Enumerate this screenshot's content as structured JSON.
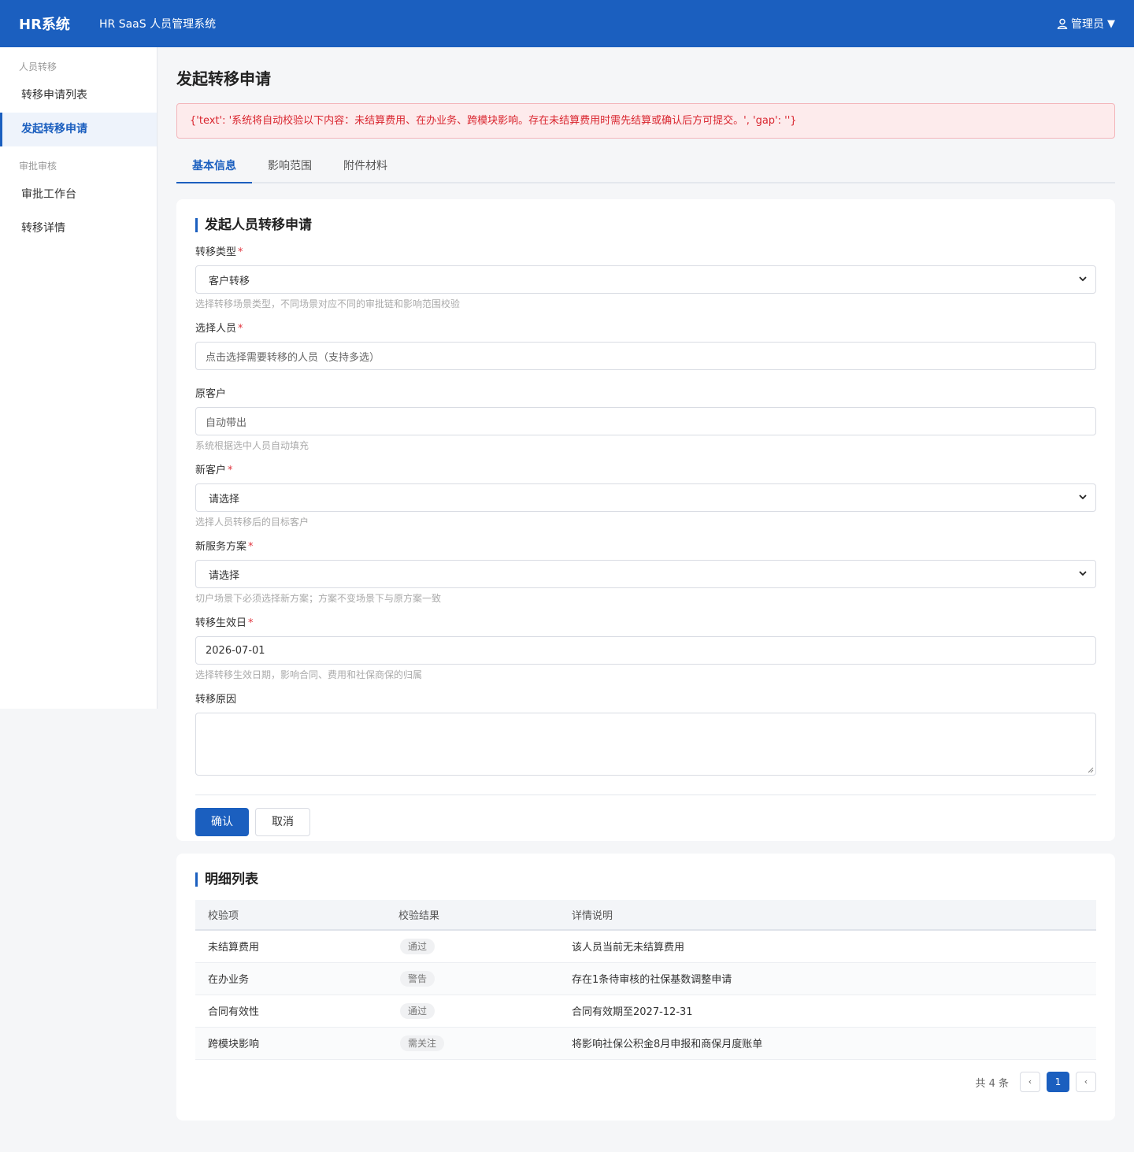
{
  "header": {
    "brand": "HR系统",
    "subtitle": "HR SaaS 人员管理系统",
    "user": "管理员",
    "caret": "▼"
  },
  "sidebar": {
    "groups": [
      {
        "title": "人员转移",
        "items": [
          "转移申请列表",
          "发起转移申请"
        ]
      },
      {
        "title": "审批审核",
        "items": [
          "审批工作台",
          "转移详情"
        ]
      }
    ],
    "active": "发起转移申请"
  },
  "page": {
    "title": "发起转移申请",
    "alert": "{'text': '系统将自动校验以下内容：未结算费用、在办业务、跨模块影响。存在未结算费用时需先结算或确认后方可提交。', 'gap': ''}"
  },
  "tabs": [
    "基本信息",
    "影响范围",
    "附件材料"
  ],
  "form": {
    "title": "发起人员转移申请",
    "required_mark": "*",
    "fields": {
      "transfer_type": {
        "label": "转移类型",
        "value": "客户转移",
        "hint": "选择转移场景类型，不同场景对应不同的审批链和影响范围校验"
      },
      "personnel": {
        "label": "选择人员",
        "placeholder": "点击选择需要转移的人员（支持多选）"
      },
      "orig_customer": {
        "label": "原客户",
        "placeholder": "自动带出",
        "hint": "系统根据选中人员自动填充"
      },
      "new_customer": {
        "label": "新客户",
        "value": "请选择",
        "hint": "选择人员转移后的目标客户"
      },
      "new_plan": {
        "label": "新服务方案",
        "value": "请选择",
        "hint": "切户场景下必须选择新方案；方案不变场景下与原方案一致"
      },
      "effective_date": {
        "label": "转移生效日",
        "value": "2026-07-01",
        "hint": "选择转移生效日期，影响合同、费用和社保商保的归属"
      },
      "reason": {
        "label": "转移原因"
      }
    },
    "confirm_label": "确认",
    "cancel_label": "取消"
  },
  "list": {
    "title": "明细列表",
    "columns": [
      "校验项",
      "校验结果",
      "详情说明"
    ],
    "rows": [
      {
        "item": "未结算费用",
        "result": "通过",
        "detail": "该人员当前无未结算费用"
      },
      {
        "item": "在办业务",
        "result": "警告",
        "detail": "存在1条待审核的社保基数调整申请"
      },
      {
        "item": "合同有效性",
        "result": "通过",
        "detail": "合同有效期至2027-12-31"
      },
      {
        "item": "跨模块影响",
        "result": "需关注",
        "detail": "将影响社保公积金8月申报和商保月度账单"
      }
    ],
    "pagination": {
      "total_text": "共 4 条",
      "prev": "‹",
      "current": "1",
      "next": "‹"
    }
  },
  "colors": {
    "primary": "#1b5fbf",
    "alert_bg": "#fdebec",
    "alert_text": "#d9262f"
  }
}
